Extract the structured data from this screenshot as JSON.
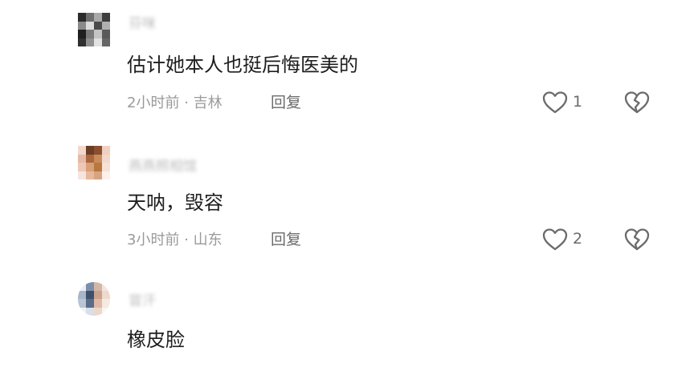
{
  "comments": [
    {
      "username": "芬咪",
      "text": "估计她本人也挺后悔医美的",
      "time": "2小时前",
      "location": "吉林",
      "reply_label": "回复",
      "likes": "1",
      "avatar_colors": [
        "#2b2b2b",
        "#6e6e6e",
        "#a9a9a9",
        "#3d3d3d",
        "#8a8a8a",
        "#dcdcdc",
        "#4a4a4a",
        "#b0b0b0",
        "#1f1f1f",
        "#7a7a7a",
        "#c4c4c4",
        "#5a5a5a",
        "#303030",
        "#909090",
        "#e2e2e2",
        "#666666"
      ]
    },
    {
      "username": "燕燕照相馆",
      "text": "天呐，毁容",
      "time": "3小时前",
      "location": "山东",
      "reply_label": "回复",
      "likes": "2",
      "avatar_colors": [
        "#f2d9c9",
        "#6b3e24",
        "#8a4f2e",
        "#f0d0c0",
        "#e8b9a8",
        "#a8673d",
        "#c98b5c",
        "#f3d8cc",
        "#efc7b7",
        "#d8a07a",
        "#b7773f",
        "#f6e1d6",
        "#f4e6de",
        "#e7b89c",
        "#d6a482",
        "#fbf0ea"
      ]
    },
    {
      "username": "冒汗",
      "text": "橡皮脸",
      "avatar_colors": [
        "#e9eef5",
        "#7d8ea8",
        "#d4b8a6",
        "#f3e5dc",
        "#a7b5c9",
        "#3e4f6a",
        "#caa28e",
        "#eed9cd",
        "#b9c4d4",
        "#5a6c88",
        "#e0b9a6",
        "#f5e9e1",
        "#f0f2f6",
        "#d9dfe8",
        "#ecd7cb",
        "#fbf5f1"
      ]
    }
  ],
  "colors": {
    "text": "#1e1e1e",
    "meta": "#9a9a9a",
    "action": "#6b6b6b"
  },
  "icons": {
    "like": "heart-outline-icon",
    "dislike": "broken-heart-icon"
  }
}
